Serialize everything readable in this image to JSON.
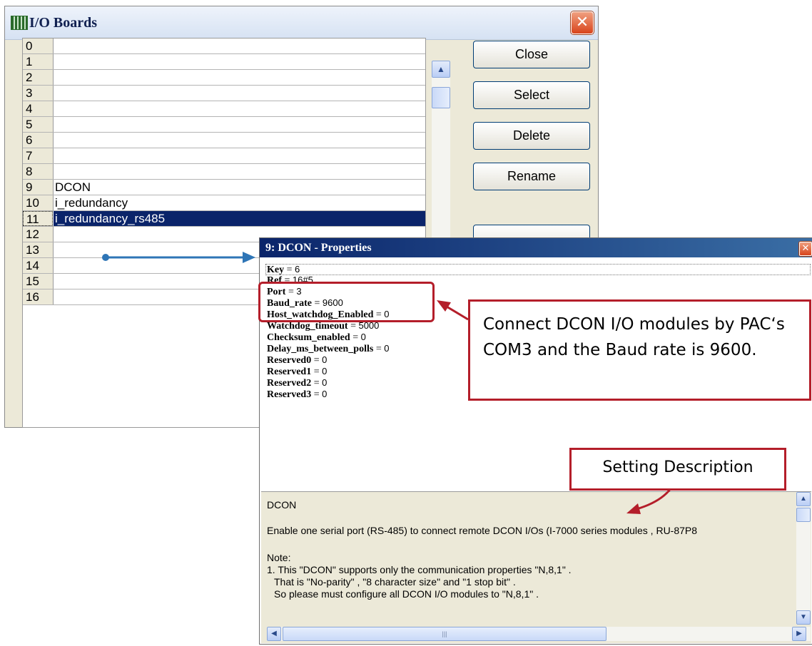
{
  "io_window": {
    "title": "I/O Boards",
    "close_glyph": "✕",
    "rows": [
      {
        "num": "0",
        "name": ""
      },
      {
        "num": "1",
        "name": ""
      },
      {
        "num": "2",
        "name": ""
      },
      {
        "num": "3",
        "name": ""
      },
      {
        "num": "4",
        "name": ""
      },
      {
        "num": "5",
        "name": ""
      },
      {
        "num": "6",
        "name": ""
      },
      {
        "num": "7",
        "name": ""
      },
      {
        "num": "8",
        "name": ""
      },
      {
        "num": "9",
        "name": "DCON"
      },
      {
        "num": "10",
        "name": "i_redundancy"
      },
      {
        "num": "11",
        "name": "i_redundancy_rs485"
      },
      {
        "num": "12",
        "name": ""
      },
      {
        "num": "13",
        "name": ""
      },
      {
        "num": "14",
        "name": ""
      },
      {
        "num": "15",
        "name": ""
      },
      {
        "num": "16",
        "name": ""
      }
    ],
    "selected_row": "11",
    "buttons": {
      "close": "Close",
      "select": "Select",
      "delete": "Delete",
      "rename": "Rename"
    }
  },
  "props_window": {
    "title": "9: DCON - Properties",
    "close_glyph": "✕",
    "properties": [
      {
        "key": "Key",
        "value": "6"
      },
      {
        "key": "Ref",
        "value": "16#5"
      },
      {
        "key": "Port",
        "value": "3"
      },
      {
        "key": "Baud_rate",
        "value": "9600"
      },
      {
        "key": "Host_watchdog_Enabled",
        "value": "0"
      },
      {
        "key": "Watchdog_timeout",
        "value": "5000"
      },
      {
        "key": "Checksum_enabled",
        "value": "0"
      },
      {
        "key": "Delay_ms_between_polls",
        "value": "0"
      },
      {
        "key": "Reserved0",
        "value": "0"
      },
      {
        "key": "Reserved1",
        "value": "0"
      },
      {
        "key": "Reserved2",
        "value": "0"
      },
      {
        "key": "Reserved3",
        "value": "0"
      }
    ],
    "description": {
      "heading": "DCON",
      "line1": "Enable one serial port (RS-485) to connect remote DCON I/Os (I-7000 series modules , RU-87P8",
      "note": "Note:",
      "line2": "1. This \"DCON\" supports only the communication properties \"N,8,1\" .",
      "line3": "That is \"No-parity\" , \"8 character size\" and \"1 stop bit\" .",
      "line4": "So please must configure all DCON I/O modules to \"N,8,1\" ."
    }
  },
  "annotations": {
    "callout_main": "Connect DCON I/O modules by PAC‘s COM3 and the Baud rate is 9600.",
    "callout_setting": "Setting Description"
  },
  "colors": {
    "annotation_red": "#b41e2a",
    "arrow_blue": "#2e75b6",
    "selection_blue": "#0a246a"
  }
}
